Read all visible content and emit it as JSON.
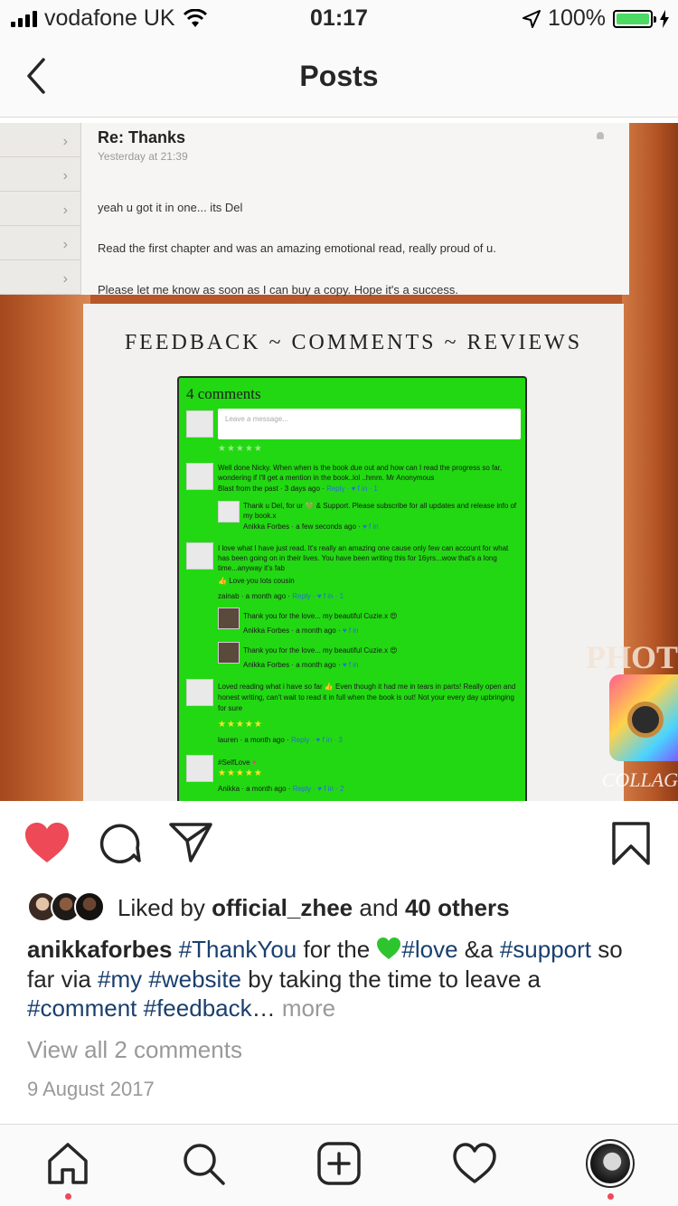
{
  "status": {
    "carrier": "vodafone UK",
    "time": "01:17",
    "battery": "100%"
  },
  "header": {
    "title": "Posts"
  },
  "post_image": {
    "email": {
      "subject": "Re: Thanks",
      "timestamp": "Yesterday at 21:39",
      "line1": "yeah u got it in one... its Del",
      "line2": "Read the first chapter and was an amazing emotional read, really proud of u.",
      "line3": "Please let me know as soon as I can buy a copy. Hope it's a success."
    },
    "banner_heading": "FEEDBACK ~ COMMENTS ~ REVIEWS",
    "comments_count": "4 comments",
    "message_placeholder": "Leave a message...",
    "comments": [
      {
        "text": "Well done Nicky. When when is the book due out and how can I read the progress so far, wondering if I'll get a mention in the book..lol ..hmm. Mr Anonymous",
        "meta": "Blast from the past · 3 days ago ·"
      },
      {
        "text": "Thank u Del, for ur 💚 & Support. Please subscribe for all updates and release info of my book.x",
        "meta": "Anikka Forbes · a few seconds ago ·"
      },
      {
        "text": "I love what I have just read. It's really an amazing one cause only few can account for what has been going on in their lives. You have been writing this for 16yrs...wow that's a long time...anyway it's fab",
        "extra": "Love you lots cousin",
        "meta": "zainab · a month ago ·"
      },
      {
        "text": "Thank you for the love... my beautiful Cuzie.x",
        "meta": "Anikka Forbes · a month ago ·"
      },
      {
        "text": "Thank you for the love... my beautiful Cuzie.x",
        "meta": "Anikka Forbes · a month ago ·"
      },
      {
        "text": "Loved reading what i have so far 👍 Even though it had me in tears in parts! Really open and honest writing, can't wait to read it in full when the book is out! Not your every day upbringing for sure",
        "meta": "lauren · a month ago ·"
      },
      {
        "text": "#SelfLove",
        "meta": "Anikka · a month ago ·"
      }
    ],
    "watermark_top": "PHOT",
    "watermark_bottom": "COLLAG"
  },
  "likes": {
    "prefix": "Liked by ",
    "user": "official_zhee",
    "middle": " and ",
    "others": "40 others"
  },
  "caption": {
    "user": "anikkaforbes",
    "parts": [
      "#ThankYou",
      " for the ",
      "#love",
      " &a ",
      "#support",
      " so far via ",
      "#my",
      " ",
      "#website",
      " by taking the time to leave a ",
      "#comment",
      " ",
      "#feedback",
      "… ",
      "more"
    ]
  },
  "view_comments": "View all 2 comments",
  "date": "9 August 2017",
  "colors": {
    "like_red": "#ed4956",
    "tag_blue": "#1a3f6e",
    "grey": "#999999"
  },
  "icons": [
    "back-chevron-icon",
    "heart-icon",
    "comment-icon",
    "share-icon",
    "bookmark-icon",
    "home-icon",
    "search-icon",
    "new-post-icon",
    "activity-icon",
    "profile-avatar"
  ]
}
